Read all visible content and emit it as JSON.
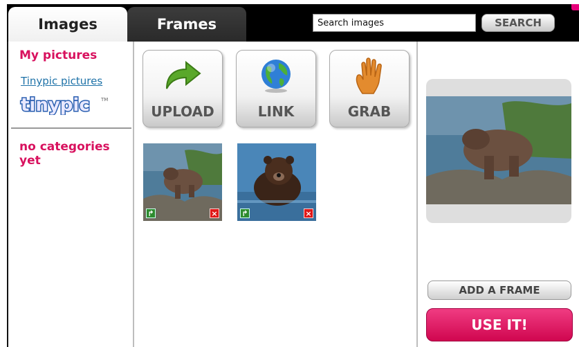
{
  "tabs": [
    {
      "label": "Images",
      "active": true
    },
    {
      "label": "Frames",
      "active": false
    }
  ],
  "search": {
    "value": "Search images",
    "button_label": "SEARCH"
  },
  "sidebar": {
    "heading": "My pictures",
    "link_label": "Tinypic pictures",
    "logo_text": "tinypic",
    "logo_mark": "TM",
    "categories_text": "no categories yet"
  },
  "actions": [
    {
      "label": "UPLOAD",
      "icon": "upload-arrow-icon"
    },
    {
      "label": "LINK",
      "icon": "globe-icon"
    },
    {
      "label": "GRAB",
      "icon": "hand-icon"
    }
  ],
  "thumbnails": [
    {
      "subject": "bear on rocks",
      "use_icon": "use-arrow-icon",
      "delete_icon": "delete-x-icon"
    },
    {
      "subject": "bear in water",
      "use_icon": "use-arrow-icon",
      "delete_icon": "delete-x-icon"
    }
  ],
  "preview": {
    "add_frame_label": "ADD A FRAME",
    "use_label": "USE IT!"
  },
  "colors": {
    "accent": "#d8115e",
    "link": "#1e72a8",
    "use_button": "#e0145f",
    "tab_bar": "#000000"
  }
}
